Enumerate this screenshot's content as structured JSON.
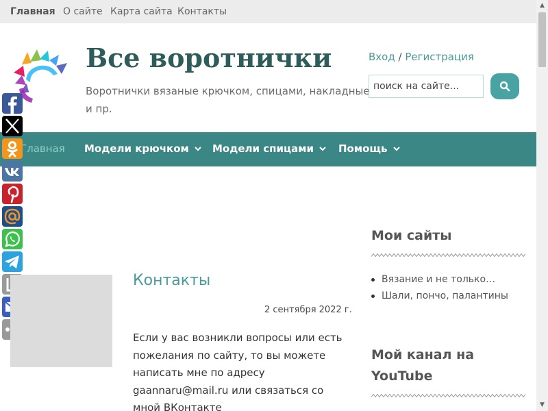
{
  "topbar": {
    "items": [
      {
        "label": "Главная",
        "active": true
      },
      {
        "label": "О сайте"
      },
      {
        "label": "Карта сайта"
      },
      {
        "label": "Контакты"
      }
    ]
  },
  "header": {
    "title": "Все воротнички",
    "description": "Воротнички вязаные крючком, спицами, накладные и пр.",
    "login_label": "Вход",
    "separator": " / ",
    "register_label": "Регистрация",
    "search_placeholder": "поиск на сайте...",
    "search_icon": "search-icon"
  },
  "nav": {
    "items": [
      {
        "label": "Главная",
        "active": true
      },
      {
        "label": "Модели крючком",
        "has_dropdown": true
      },
      {
        "label": "Модели спицами",
        "has_dropdown": true
      },
      {
        "label": "Помощь",
        "has_dropdown": true
      }
    ]
  },
  "share": [
    {
      "name": "facebook",
      "color": "#3b5998",
      "glyph": "f"
    },
    {
      "name": "x",
      "color": "#000000",
      "glyph": "X"
    },
    {
      "name": "odnoklassniki",
      "color": "#f2951f",
      "glyph": "ok"
    },
    {
      "name": "vkontakte",
      "color": "#4c75a3",
      "glyph": "vk"
    },
    {
      "name": "pinterest",
      "color": "#c8232c",
      "glyph": "P"
    },
    {
      "name": "mail-ru",
      "color": "#1b4f8f",
      "glyph": "@"
    },
    {
      "name": "whatsapp",
      "color": "#3ec04d",
      "glyph": "wa"
    },
    {
      "name": "telegram",
      "color": "#2aa3e0",
      "glyph": "tg"
    },
    {
      "name": "liveinternet",
      "color": "#9a9a9a",
      "glyph": "Li"
    },
    {
      "name": "email",
      "color": "#3b5fbf",
      "glyph": "mail"
    },
    {
      "name": "more",
      "color": "#999999",
      "glyph": "more"
    }
  ],
  "post": {
    "title": "Контакты",
    "date": "2 сентября 2022 г.",
    "text_lines": [
      "Если у вас возникли вопросы или есть",
      "пожелания по сайту, то вы можете",
      "написать мне по адресу",
      "gaannaru@mail.ru или связаться со",
      "мной ВКонтакте"
    ]
  },
  "sidebar": {
    "widget1_title": "Мои сайты",
    "widget1_items": [
      "Вязание и не только…",
      "Шали, пончо, палантины"
    ],
    "widget2_title_line1": "Мой канал на",
    "widget2_title_line2": "YouTube"
  },
  "colors": {
    "accent": "#3a8785",
    "link": "#4a9a9a",
    "title": "#2e5c5a"
  }
}
